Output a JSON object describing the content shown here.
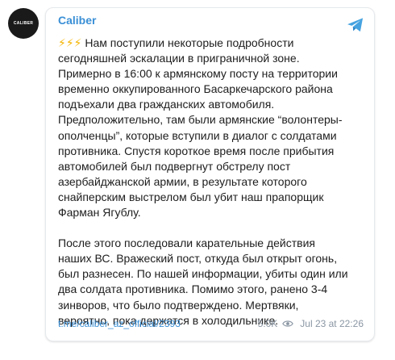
{
  "avatar": {
    "logo_text": "CALIBER"
  },
  "post": {
    "channel_name": "Caliber",
    "icon": "telegram-icon",
    "emoji": "⚡⚡⚡",
    "paragraph1": "Нам поступили некоторые подробности\nсегодняшней эскалации в приграничной зоне.\nПримерно в 16:00 к армянскому посту на территории\nвременно оккупированного Басаркечарского района\nподъехали два гражданских автомобиля.\nПредположительно, там были армянские “волонтеры-\nополченцы”, которые вступили в диалог с солдатами\nпротивника. Спустя короткое время после прибытия\nавтомобилей был подвергнут обстрелу пост\nазербайджанской армии, в результате которого\nснайперским выстрелом был убит наш прапорщик\nФарман Ягублу.",
    "paragraph2": "После этого последовали карательные действия\nнаших ВС. Вражеский пост, откуда был открыт огонь,\nбыл разнесен. По нашей информации, убиты один или\nдва солдата противника. Помимо этого, ранено 3-4\nзинворов, что было подтверждено. Мертвяки,\nвероятно, пока держатся в холодильнике.",
    "link": "t.me/caliber_az_official/2393",
    "views": "5.0K",
    "date": "Jul 23 at 22:26"
  },
  "colors": {
    "accent": "#3a8fd6",
    "meta": "#8a96a3",
    "emoji": "#f4b400"
  }
}
